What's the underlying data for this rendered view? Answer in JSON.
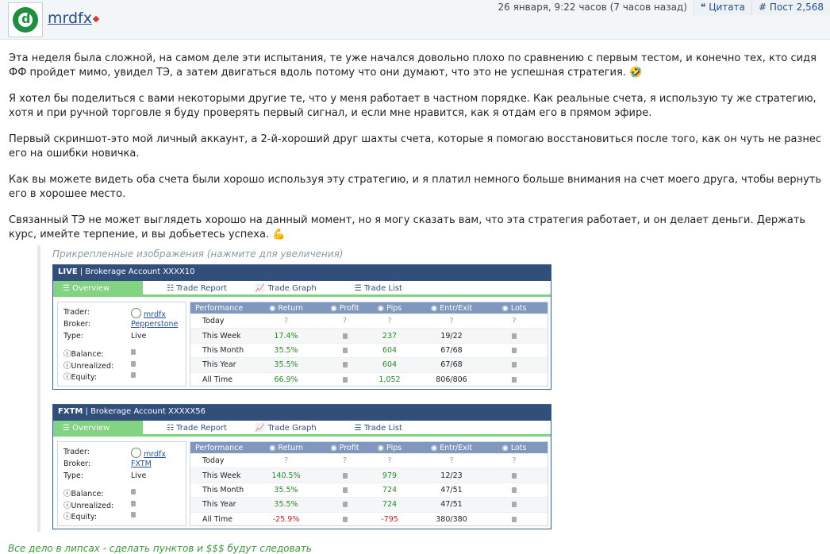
{
  "header": {
    "username": "mrdfx",
    "date": "26 января, 9:22 часов (7 часов назад)",
    "cite_label": "Цитата",
    "post_label": "Пост 2,568"
  },
  "body": {
    "paragraphs": [
      "Эта неделя была сложной, на самом деле эти испытания, те уже начался довольно плохо по сравнению с первым тестом, и конечно тех, кто сидя ФФ пройдет мимо, увидел ТЭ, а затем двигаться вдоль потому что они думают, что это не успешная стратегия. 🤣",
      "Я хотел бы поделиться с вами некоторыми другие те, что у меня работает в частном порядке. Как реальные счета, я использую ту же стратегию, хотя и при ручной торговле я буду проверять первый сигнал, и если мне нравится, как я отдам его в прямом эфире.",
      "Первый скриншот-это мой личный аккаунт, а 2-й-хороший друг шахты счета, которые я помогаю восстановиться после того, как он чуть не разнес его на ошибки новичка.",
      "Как вы можете видеть оба счета были хорошо используя эту стратегию, и я платил немного больше внимания на счет моего друга, чтобы вернуть его в хорошее место.",
      "Связанный ТЭ не может выглядеть хорошо на данный момент, но я могу сказать вам, что эта стратегия работает, и он делает деньги. Держать курс, имейте терпение, и вы добьетесь успеха. 💪"
    ]
  },
  "attachments": {
    "label": "Прикрепленные изображения (нажмите для увеличения)",
    "accounts": [
      {
        "badge": "LIVE",
        "title": "Brokerage Account XXXX10",
        "tabs": [
          "Overview",
          "Trade Report",
          "Trade Graph",
          "Trade List"
        ],
        "trader": "mrdfx",
        "broker": "Pepperstone",
        "type": "Live",
        "headers": [
          "Performance",
          "Return",
          "Profit",
          "Pips",
          "Entr/Exit",
          "Lots"
        ],
        "rows": [
          {
            "period": "Today",
            "return": "?",
            "profit": "?",
            "pips": "?",
            "entr": "?",
            "lots": "?"
          },
          {
            "period": "This Week",
            "return": "17.4%",
            "profit": "",
            "pips": "237",
            "entr": "19/22",
            "lots": ""
          },
          {
            "period": "This Month",
            "return": "35.5%",
            "profit": "",
            "pips": "604",
            "entr": "67/68",
            "lots": ""
          },
          {
            "period": "This Year",
            "return": "35.5%",
            "profit": "",
            "pips": "604",
            "entr": "67/68",
            "lots": ""
          },
          {
            "period": "All Time",
            "return": "66.9%",
            "profit": "",
            "pips": "1,052",
            "entr": "806/806",
            "lots": ""
          }
        ]
      },
      {
        "badge": "FXTM",
        "title": "Brokerage Account XXXXX56",
        "tabs": [
          "Overview",
          "Trade Report",
          "Trade Graph",
          "Trade List"
        ],
        "trader": "mrdfx",
        "broker": "FXTM",
        "type": "Live",
        "headers": [
          "Performance",
          "Return",
          "Profit",
          "Pips",
          "Entr/Exit",
          "Lots"
        ],
        "rows": [
          {
            "period": "Today",
            "return": "?",
            "profit": "?",
            "pips": "?",
            "entr": "?",
            "lots": "?"
          },
          {
            "period": "This Week",
            "return": "140.5%",
            "profit": "",
            "pips": "979",
            "entr": "12/23",
            "lots": ""
          },
          {
            "period": "This Month",
            "return": "35.5%",
            "profit": "",
            "pips": "724",
            "entr": "47/51",
            "lots": ""
          },
          {
            "period": "This Year",
            "return": "35.5%",
            "profit": "",
            "pips": "724",
            "entr": "47/51",
            "lots": ""
          },
          {
            "period": "All Time",
            "return": "-25.9%",
            "profit": "",
            "pips": "-795",
            "entr": "380/380",
            "lots": ""
          }
        ]
      }
    ]
  },
  "footer": {
    "text": "Все дело в липсах - сделать пунктов и $$$ будут следовать"
  }
}
